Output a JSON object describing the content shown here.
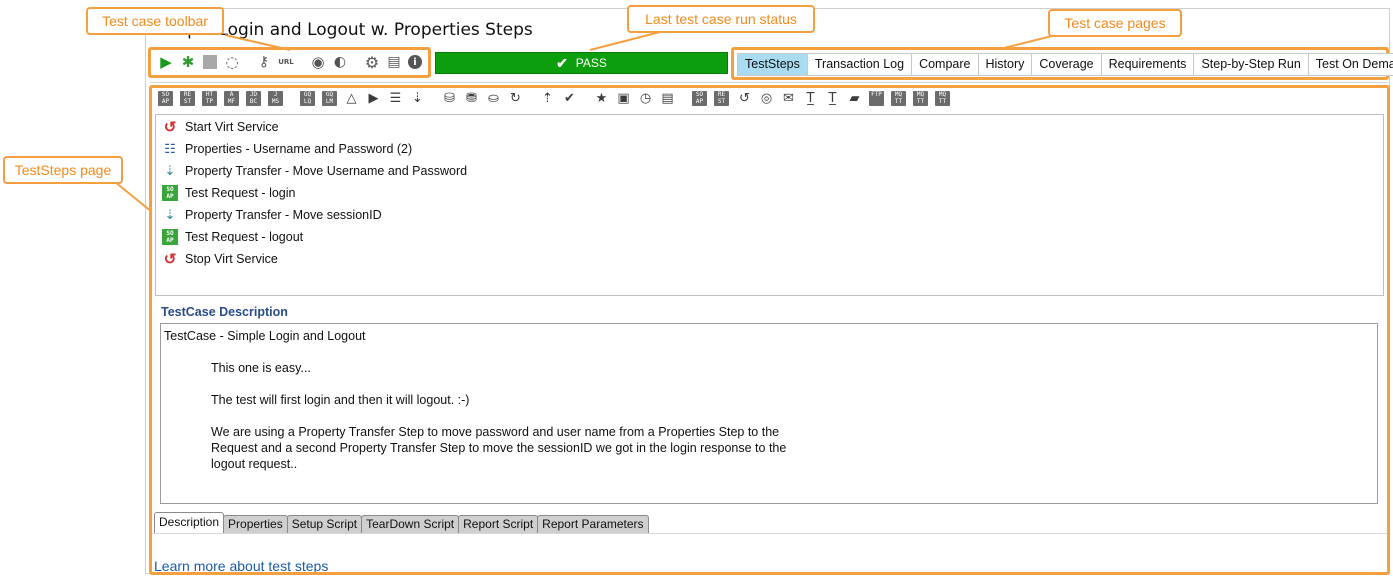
{
  "window": {
    "title": "Simple Login and Logout w. Properties Steps"
  },
  "callouts": {
    "toolbar": "Test case toolbar",
    "run_status": "Last test case run status",
    "pages": "Test case pages",
    "teststeps": "TestSteps page"
  },
  "toolbar": {
    "icons": [
      "run-icon",
      "debug-icon",
      "stop-icon",
      "loop-icon",
      "key-icon",
      "url-icon",
      "cancel-icon",
      "security-icon",
      "gear-icon",
      "document-icon",
      "info-icon"
    ],
    "url_label": "URL"
  },
  "status": {
    "text": "PASS",
    "color": "#0d9e0d"
  },
  "pages": {
    "tabs": [
      {
        "label": "TestSteps",
        "active": true
      },
      {
        "label": "Transaction Log"
      },
      {
        "label": "Compare"
      },
      {
        "label": "History"
      },
      {
        "label": "Coverage"
      },
      {
        "label": "Requirements"
      },
      {
        "label": "Step-by-Step Run"
      },
      {
        "label": "Test On Demand"
      }
    ],
    "active_color": "#a9dcf0"
  },
  "step_toolbar": {
    "icons": [
      {
        "name": "soap-icon",
        "text": "SO AP"
      },
      {
        "name": "rest-icon",
        "text": "RE ST"
      },
      {
        "name": "http-icon",
        "text": "HT TP"
      },
      {
        "name": "amf-icon",
        "text": "A MF"
      },
      {
        "name": "jdbc-icon",
        "text": "JD BC"
      },
      {
        "name": "jms-icon",
        "text": "J MS"
      },
      {
        "name": "graphql-icon",
        "text": "GQ LQ"
      },
      {
        "name": "graphql-mutation-icon",
        "text": "GQ LM"
      },
      {
        "name": "assertion-icon",
        "text": "△"
      },
      {
        "name": "run-testcase-icon",
        "text": "▶"
      },
      {
        "name": "properties-icon",
        "text": "☰"
      },
      {
        "name": "property-transfer-icon",
        "text": "⇣"
      },
      {
        "name": "datasource-icon",
        "text": "⛁"
      },
      {
        "name": "datasink-icon",
        "text": "⛃"
      },
      {
        "name": "datagen-icon",
        "text": "⛀"
      },
      {
        "name": "datasource-loop-icon",
        "text": "↻"
      },
      {
        "name": "conditional-goto-icon",
        "text": "⇡"
      },
      {
        "name": "assertion-check-icon",
        "text": "✔"
      },
      {
        "name": "favorite-icon",
        "text": "★"
      },
      {
        "name": "manual-step-icon",
        "text": "▣"
      },
      {
        "name": "delay-icon",
        "text": "◷"
      },
      {
        "name": "comment-icon",
        "text": "▤"
      },
      {
        "name": "soap-mock-icon",
        "text": "SO AP"
      },
      {
        "name": "rest-mock-icon",
        "text": "RE ST"
      },
      {
        "name": "virt-icon",
        "text": "↺"
      },
      {
        "name": "web-icon",
        "text": "◎"
      },
      {
        "name": "mail-icon",
        "text": "✉"
      },
      {
        "name": "xml-icon",
        "text": "T̲"
      },
      {
        "name": "json-icon",
        "text": "T̲"
      },
      {
        "name": "folder-icon",
        "text": "▰"
      },
      {
        "name": "ftp-icon",
        "text": "FTP"
      },
      {
        "name": "mqtt-icon",
        "text": "MQ TT"
      },
      {
        "name": "mqtt-publish-icon",
        "text": "MQ TT"
      },
      {
        "name": "mqtt-drop-icon",
        "text": "MQ TT"
      }
    ]
  },
  "steps": [
    {
      "label": "Start Virt Service",
      "icon": "virt-service-icon"
    },
    {
      "label": "Properties - Username and Password (2)",
      "icon": "properties-icon"
    },
    {
      "label": "Property Transfer - Move Username and Password",
      "icon": "property-transfer-icon"
    },
    {
      "label": "Test Request - login",
      "icon": "soap-request-icon"
    },
    {
      "label": "Property Transfer - Move sessionID",
      "icon": "property-transfer-icon"
    },
    {
      "label": "Test Request - logout",
      "icon": "soap-request-icon"
    },
    {
      "label": "Stop Virt Service",
      "icon": "virt-service-icon"
    }
  ],
  "description": {
    "heading": "TestCase Description",
    "lines": [
      "TestCase - Simple Login and Logout",
      "This one is easy...",
      "The test will first login and then it will logout. :-)",
      "We are using a Property Transfer Step to move password and user name from a Properties Step to the",
      "Request and a second Property Transfer Step to move the sessionID we got in the login response to the",
      "logout request.."
    ]
  },
  "bottom_tabs": [
    {
      "label": "Description",
      "active": true
    },
    {
      "label": "Properties"
    },
    {
      "label": "Setup Script"
    },
    {
      "label": "TearDown Script"
    },
    {
      "label": "Report Script"
    },
    {
      "label": "Report Parameters"
    }
  ],
  "footer": {
    "link": "Learn more about test steps"
  },
  "accent": "#f5a040"
}
